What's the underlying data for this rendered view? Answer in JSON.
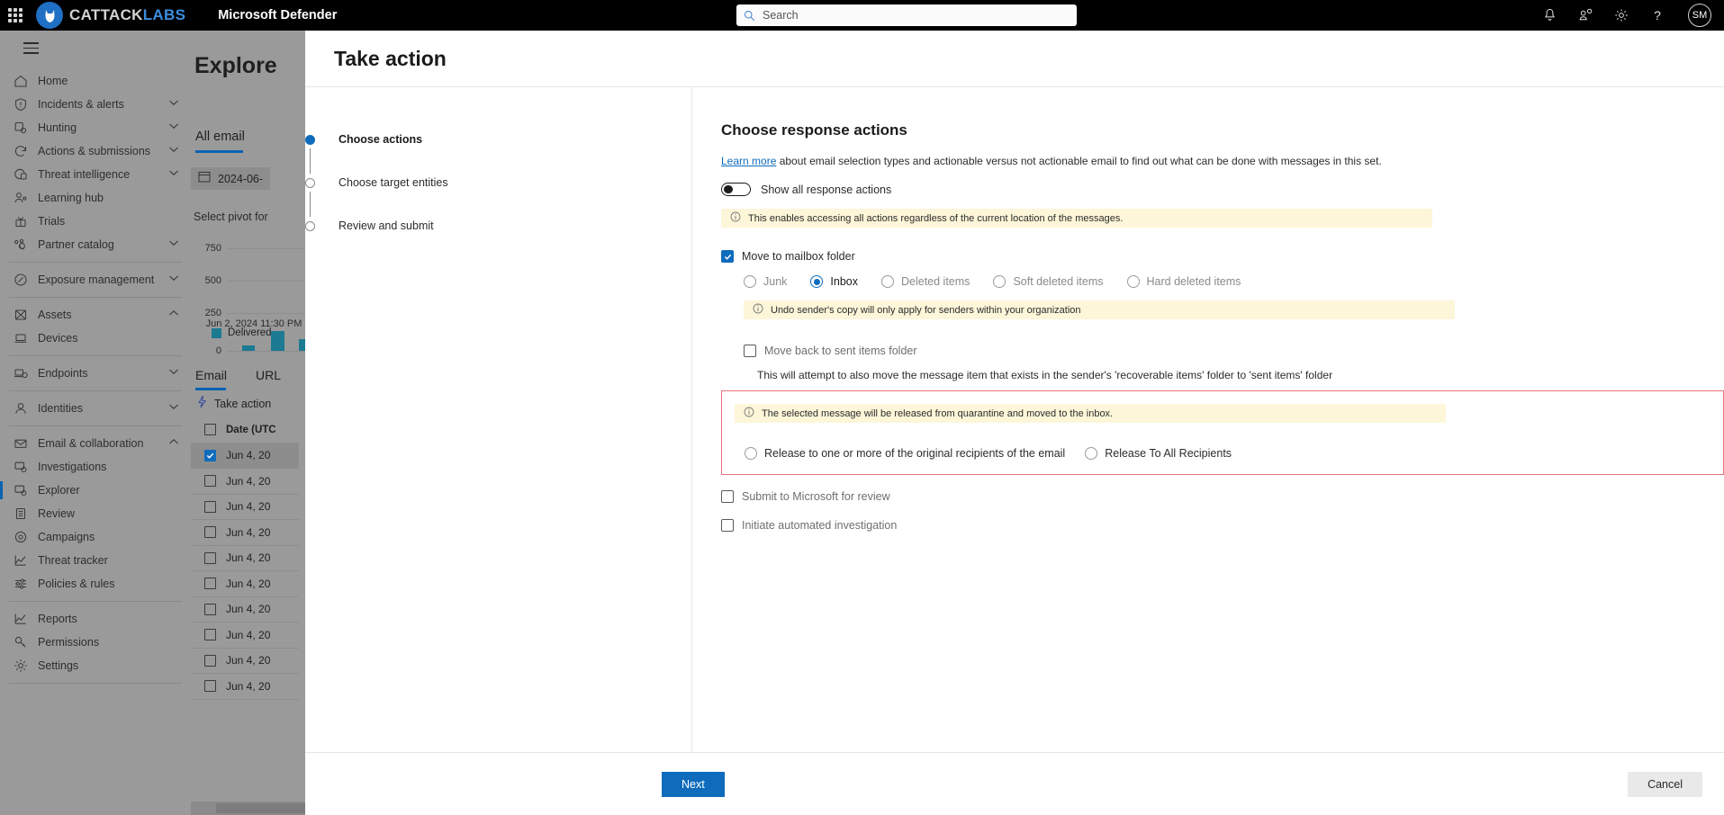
{
  "topbar": {
    "waffle_icon": "app-launcher-icon",
    "brand": {
      "part1": "CATTACK",
      "part2": "LABS"
    },
    "app_name": "Microsoft Defender",
    "search": {
      "placeholder": "Search",
      "value": "",
      "icon": "search-icon"
    },
    "icons": [
      "bell-icon",
      "people-feedback-icon",
      "gear-icon",
      "question-help-icon"
    ],
    "avatar_initials": "SM"
  },
  "sidebar": {
    "hamburger_icon": "hamburger-menu-icon",
    "items": [
      {
        "label": "Home",
        "icon": "home-icon",
        "chevron": "",
        "selected": false
      },
      {
        "label": "Incidents & alerts",
        "icon": "shield-alert-icon",
        "chevron": "down",
        "selected": false
      },
      {
        "label": "Hunting",
        "icon": "hunting-icon",
        "chevron": "down",
        "selected": false
      },
      {
        "label": "Actions & submissions",
        "icon": "actions-icon",
        "chevron": "down",
        "selected": false
      },
      {
        "label": "Threat intelligence",
        "icon": "threat-intel-icon",
        "chevron": "down",
        "selected": false
      },
      {
        "label": "Learning hub",
        "icon": "learning-hub-icon",
        "chevron": "",
        "selected": false
      },
      {
        "label": "Trials",
        "icon": "trials-icon",
        "chevron": "",
        "selected": false
      },
      {
        "label": "Partner catalog",
        "icon": "partner-catalog-icon",
        "chevron": "down",
        "selected": false
      },
      {
        "separator": true
      },
      {
        "label": "Exposure management",
        "icon": "exposure-icon",
        "chevron": "down",
        "selected": false
      },
      {
        "separator": true
      },
      {
        "label": "Assets",
        "icon": "assets-icon",
        "chevron": "up",
        "selected": false
      },
      {
        "label": "Devices",
        "icon": "devices-icon",
        "chevron": "",
        "selected": false
      },
      {
        "separator": true
      },
      {
        "label": "Endpoints",
        "icon": "endpoints-icon",
        "chevron": "down",
        "selected": false
      },
      {
        "separator": true
      },
      {
        "label": "Identities",
        "icon": "identities-icon",
        "chevron": "down",
        "selected": false
      },
      {
        "separator": true
      },
      {
        "label": "Email & collaboration",
        "icon": "email-icon",
        "chevron": "up",
        "selected": false
      },
      {
        "label": "Investigations",
        "icon": "investigations-icon",
        "chevron": "",
        "selected": false
      },
      {
        "label": "Explorer",
        "icon": "explorer-icon",
        "chevron": "",
        "selected": true
      },
      {
        "label": "Review",
        "icon": "review-icon",
        "chevron": "",
        "selected": false
      },
      {
        "label": "Campaigns",
        "icon": "campaigns-icon",
        "chevron": "",
        "selected": false
      },
      {
        "label": "Threat tracker",
        "icon": "threat-tracker-icon",
        "chevron": "",
        "selected": false
      },
      {
        "label": "Policies & rules",
        "icon": "policies-icon",
        "chevron": "",
        "selected": false
      },
      {
        "separator": true
      },
      {
        "label": "Reports",
        "icon": "reports-icon",
        "chevron": "",
        "selected": false
      },
      {
        "label": "Permissions",
        "icon": "permissions-icon",
        "chevron": "",
        "selected": false
      },
      {
        "label": "Settings",
        "icon": "settings-gear-icon",
        "chevron": "",
        "selected": false
      },
      {
        "separator": true
      }
    ]
  },
  "background_page": {
    "title": "Explore",
    "tab": "All email",
    "date_filter": "2024-06-",
    "date_icon": "calendar-icon",
    "pivot_label": "Select pivot for",
    "chart": {
      "y_ticks": [
        "750",
        "500",
        "250",
        "0"
      ],
      "x_label": "Jun 2, 2024 11:30 PM",
      "legend": "Delivered",
      "legend_color": "#1c7a92"
    },
    "tabs_row": [
      "Email",
      "URL"
    ],
    "take_action_label": "Take action",
    "take_action_icon": "lightning-bolt-icon",
    "table_header": "Date (UTC",
    "rows": [
      {
        "date": "Jun 4, 20",
        "checked": true
      },
      {
        "date": "Jun 4, 20",
        "checked": false
      },
      {
        "date": "Jun 4, 20",
        "checked": false
      },
      {
        "date": "Jun 4, 20",
        "checked": false
      },
      {
        "date": "Jun 4, 20",
        "checked": false
      },
      {
        "date": "Jun 4, 20",
        "checked": false
      },
      {
        "date": "Jun 4, 20",
        "checked": false
      },
      {
        "date": "Jun 4, 20",
        "checked": false
      },
      {
        "date": "Jun 4, 20",
        "checked": false
      },
      {
        "date": "Jun 4, 20",
        "checked": false
      }
    ]
  },
  "modal": {
    "title": "Take action",
    "wizard": {
      "steps": [
        {
          "label": "Choose actions",
          "active": true
        },
        {
          "label": "Choose target entities",
          "active": false
        },
        {
          "label": "Review and submit",
          "active": false
        }
      ]
    },
    "content": {
      "heading": "Choose response actions",
      "learn_more_link": "Learn more",
      "learn_more_rest": " about email selection types and actionable versus not actionable email to find out what can be done with messages in this set.",
      "show_all_toggle": {
        "label": "Show all response actions",
        "on": false
      },
      "info_show_all": "This enables accessing all actions regardless of the current location of the messages.",
      "info_icon": "info-circle-icon",
      "move_to_mailbox": {
        "label": "Move to mailbox folder",
        "checked": true,
        "options": [
          {
            "label": "Junk",
            "selected": false
          },
          {
            "label": "Inbox",
            "selected": true
          },
          {
            "label": "Deleted items",
            "selected": false
          },
          {
            "label": "Soft deleted items",
            "selected": false
          },
          {
            "label": "Hard deleted items",
            "selected": false
          }
        ],
        "info": "Undo sender's copy will only apply for senders within your organization"
      },
      "move_back_sent": {
        "label": "Move back to sent items folder",
        "checked": false,
        "helper": "This will attempt to also move the message item that exists in the sender's 'recoverable items' folder to 'sent items' folder"
      },
      "release_box": {
        "highlight_color": "#e8737a",
        "info": "The selected message will be released from quarantine and moved to the inbox.",
        "options": [
          {
            "label": "Release to one or more of the original recipients of the email",
            "selected": false
          },
          {
            "label": "Release To All Recipients",
            "selected": false
          }
        ]
      },
      "submit_microsoft": {
        "label": "Submit to Microsoft for review",
        "checked": false
      },
      "initiate_investigation": {
        "label": "Initiate automated investigation",
        "checked": false
      }
    },
    "footer": {
      "next_label": "Next",
      "cancel_label": "Cancel",
      "next_color": "#0f6cbd"
    }
  }
}
